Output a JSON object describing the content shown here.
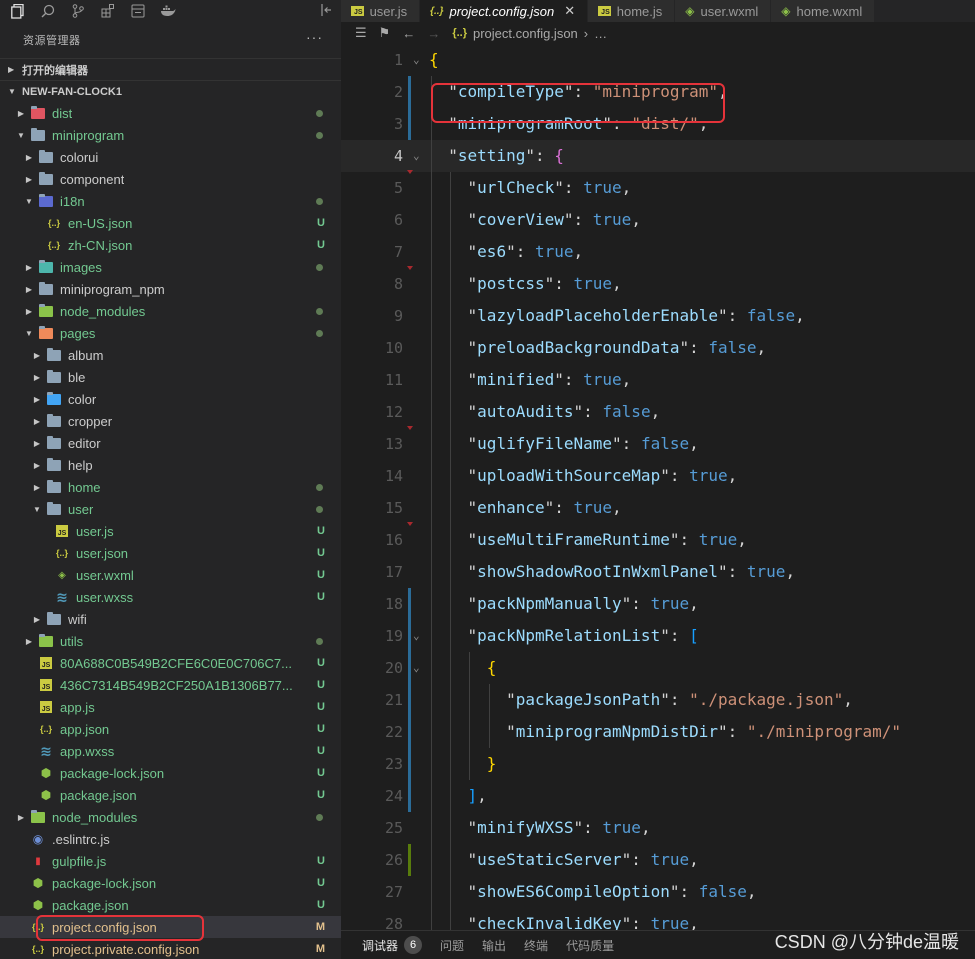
{
  "sidebar": {
    "title": "资源管理器",
    "more_label": "···",
    "open_editors_label": "打开的编辑器",
    "project_label": "NEW-FAN-CLOCK1",
    "items": [
      {
        "name": "dist",
        "depth": 1,
        "kind": "folder",
        "open": false,
        "status": "dot",
        "color": "green",
        "icon_color": "#e05561"
      },
      {
        "name": "miniprogram",
        "depth": 1,
        "kind": "folder",
        "open": true,
        "status": "dot",
        "color": "green",
        "icon_color": "#8ea3b6"
      },
      {
        "name": "colorui",
        "depth": 2,
        "kind": "folder",
        "open": false,
        "status": "",
        "color": "norm",
        "icon_color": "#8ea3b6"
      },
      {
        "name": "component",
        "depth": 2,
        "kind": "folder",
        "open": false,
        "status": "",
        "color": "norm",
        "icon_color": "#8ea3b6"
      },
      {
        "name": "i18n",
        "depth": 2,
        "kind": "folder",
        "open": true,
        "status": "dot",
        "color": "green",
        "icon_color": "#5b6ad0"
      },
      {
        "name": "en-US.json",
        "depth": 3,
        "kind": "json",
        "status": "U",
        "color": "green"
      },
      {
        "name": "zh-CN.json",
        "depth": 3,
        "kind": "json",
        "status": "U",
        "color": "green"
      },
      {
        "name": "images",
        "depth": 2,
        "kind": "folder",
        "open": false,
        "status": "dot",
        "color": "green",
        "icon_color": "#4db6ac"
      },
      {
        "name": "miniprogram_npm",
        "depth": 2,
        "kind": "folder",
        "open": false,
        "status": "",
        "color": "norm",
        "icon_color": "#8ea3b6"
      },
      {
        "name": "node_modules",
        "depth": 2,
        "kind": "folder",
        "open": false,
        "status": "dot",
        "color": "green",
        "icon_color": "#8bc34a"
      },
      {
        "name": "pages",
        "depth": 2,
        "kind": "folder",
        "open": true,
        "status": "dot",
        "color": "green",
        "icon_color": "#ef8a5a"
      },
      {
        "name": "album",
        "depth": 3,
        "kind": "folder",
        "open": false,
        "status": "",
        "color": "norm",
        "icon_color": "#8ea3b6"
      },
      {
        "name": "ble",
        "depth": 3,
        "kind": "folder",
        "open": false,
        "status": "",
        "color": "norm",
        "icon_color": "#8ea3b6"
      },
      {
        "name": "color",
        "depth": 3,
        "kind": "folder",
        "open": false,
        "status": "",
        "color": "norm",
        "icon_color": "#42a5f5"
      },
      {
        "name": "cropper",
        "depth": 3,
        "kind": "folder",
        "open": false,
        "status": "",
        "color": "norm",
        "icon_color": "#8ea3b6"
      },
      {
        "name": "editor",
        "depth": 3,
        "kind": "folder",
        "open": false,
        "status": "",
        "color": "norm",
        "icon_color": "#8ea3b6"
      },
      {
        "name": "help",
        "depth": 3,
        "kind": "folder",
        "open": false,
        "status": "",
        "color": "norm",
        "icon_color": "#8ea3b6"
      },
      {
        "name": "home",
        "depth": 3,
        "kind": "folder",
        "open": false,
        "status": "dot",
        "color": "green",
        "icon_color": "#8ea3b6"
      },
      {
        "name": "user",
        "depth": 3,
        "kind": "folder",
        "open": true,
        "status": "dot",
        "color": "green",
        "icon_color": "#8ea3b6"
      },
      {
        "name": "user.js",
        "depth": 4,
        "kind": "js",
        "status": "U",
        "color": "green"
      },
      {
        "name": "user.json",
        "depth": 4,
        "kind": "json",
        "status": "U",
        "color": "green"
      },
      {
        "name": "user.wxml",
        "depth": 4,
        "kind": "wxml",
        "status": "U",
        "color": "green"
      },
      {
        "name": "user.wxss",
        "depth": 4,
        "kind": "wxss",
        "status": "U",
        "color": "green"
      },
      {
        "name": "wifi",
        "depth": 3,
        "kind": "folder",
        "open": false,
        "status": "",
        "color": "norm",
        "icon_color": "#8ea3b6"
      },
      {
        "name": "utils",
        "depth": 2,
        "kind": "folder",
        "open": false,
        "status": "dot",
        "color": "green",
        "icon_color": "#8bc34a"
      },
      {
        "name": "80A688C0B549B2CFE6C0E0C706C7...",
        "depth": 2,
        "kind": "js",
        "status": "U",
        "color": "green"
      },
      {
        "name": "436C7314B549B2CF250A1B1306B77...",
        "depth": 2,
        "kind": "js",
        "status": "U",
        "color": "green"
      },
      {
        "name": "app.js",
        "depth": 2,
        "kind": "js",
        "status": "U",
        "color": "green"
      },
      {
        "name": "app.json",
        "depth": 2,
        "kind": "json",
        "status": "U",
        "color": "green"
      },
      {
        "name": "app.wxss",
        "depth": 2,
        "kind": "wxss",
        "status": "U",
        "color": "green"
      },
      {
        "name": "package-lock.json",
        "depth": 2,
        "kind": "npm",
        "status": "U",
        "color": "green"
      },
      {
        "name": "package.json",
        "depth": 2,
        "kind": "npm",
        "status": "U",
        "color": "green"
      },
      {
        "name": "node_modules",
        "depth": 1,
        "kind": "folder",
        "open": false,
        "status": "dot",
        "color": "green",
        "icon_color": "#8bc34a"
      },
      {
        "name": ".eslintrc.js",
        "depth": 1,
        "kind": "eslint",
        "status": "",
        "color": "norm"
      },
      {
        "name": "gulpfile.js",
        "depth": 1,
        "kind": "gulp",
        "status": "U",
        "color": "green"
      },
      {
        "name": "package-lock.json",
        "depth": 1,
        "kind": "npm",
        "status": "U",
        "color": "green"
      },
      {
        "name": "package.json",
        "depth": 1,
        "kind": "npm",
        "status": "U",
        "color": "green"
      },
      {
        "name": "project.config.json",
        "depth": 1,
        "kind": "json",
        "status": "M",
        "color": "mod",
        "selected": true,
        "boxed": true
      },
      {
        "name": "project.private.config.json",
        "depth": 1,
        "kind": "json",
        "status": "M",
        "color": "mod"
      }
    ]
  },
  "tabs": [
    {
      "label": "user.js",
      "kind": "js",
      "active": false
    },
    {
      "label": "project.config.json",
      "kind": "json",
      "active": true
    },
    {
      "label": "home.js",
      "kind": "js",
      "active": false
    },
    {
      "label": "user.wxml",
      "kind": "wxml",
      "active": false
    },
    {
      "label": "home.wxml",
      "kind": "wxml",
      "active": false
    }
  ],
  "breadcrumb": {
    "file": "project.config.json",
    "rest": "…"
  },
  "code_lines": [
    {
      "n": 1,
      "parts": [
        [
          "y",
          "{"
        ]
      ]
    },
    {
      "n": 2,
      "parts": [
        [
          "p",
          "  \""
        ],
        [
          "k",
          "compileType"
        ],
        [
          "p",
          "\": "
        ],
        [
          "s",
          "\"miniprogram\""
        ],
        [
          "p",
          ","
        ]
      ]
    },
    {
      "n": 3,
      "parts": [
        [
          "p",
          "  \""
        ],
        [
          "k",
          "miniprogramRoot"
        ],
        [
          "p",
          "\": "
        ],
        [
          "s",
          "\"dist/\""
        ],
        [
          "p",
          ","
        ]
      ]
    },
    {
      "n": 4,
      "parts": [
        [
          "p",
          "  \""
        ],
        [
          "k",
          "setting"
        ],
        [
          "p",
          "\": "
        ],
        [
          "m",
          "{"
        ]
      ]
    },
    {
      "n": 5,
      "parts": [
        [
          "p",
          "    \""
        ],
        [
          "k",
          "urlCheck"
        ],
        [
          "p",
          "\": "
        ],
        [
          "b",
          "true"
        ],
        [
          "p",
          ","
        ]
      ]
    },
    {
      "n": 6,
      "parts": [
        [
          "p",
          "    \""
        ],
        [
          "k",
          "coverView"
        ],
        [
          "p",
          "\": "
        ],
        [
          "b",
          "true"
        ],
        [
          "p",
          ","
        ]
      ]
    },
    {
      "n": 7,
      "parts": [
        [
          "p",
          "    \""
        ],
        [
          "k",
          "es6"
        ],
        [
          "p",
          "\": "
        ],
        [
          "b",
          "true"
        ],
        [
          "p",
          ","
        ]
      ]
    },
    {
      "n": 8,
      "parts": [
        [
          "p",
          "    \""
        ],
        [
          "k",
          "postcss"
        ],
        [
          "p",
          "\": "
        ],
        [
          "b",
          "true"
        ],
        [
          "p",
          ","
        ]
      ]
    },
    {
      "n": 9,
      "parts": [
        [
          "p",
          "    \""
        ],
        [
          "k",
          "lazyloadPlaceholderEnable"
        ],
        [
          "p",
          "\": "
        ],
        [
          "b",
          "false"
        ],
        [
          "p",
          ","
        ]
      ]
    },
    {
      "n": 10,
      "parts": [
        [
          "p",
          "    \""
        ],
        [
          "k",
          "preloadBackgroundData"
        ],
        [
          "p",
          "\": "
        ],
        [
          "b",
          "false"
        ],
        [
          "p",
          ","
        ]
      ]
    },
    {
      "n": 11,
      "parts": [
        [
          "p",
          "    \""
        ],
        [
          "k",
          "minified"
        ],
        [
          "p",
          "\": "
        ],
        [
          "b",
          "true"
        ],
        [
          "p",
          ","
        ]
      ]
    },
    {
      "n": 12,
      "parts": [
        [
          "p",
          "    \""
        ],
        [
          "k",
          "autoAudits"
        ],
        [
          "p",
          "\": "
        ],
        [
          "b",
          "false"
        ],
        [
          "p",
          ","
        ]
      ]
    },
    {
      "n": 13,
      "parts": [
        [
          "p",
          "    \""
        ],
        [
          "k",
          "uglifyFileName"
        ],
        [
          "p",
          "\": "
        ],
        [
          "b",
          "false"
        ],
        [
          "p",
          ","
        ]
      ]
    },
    {
      "n": 14,
      "parts": [
        [
          "p",
          "    \""
        ],
        [
          "k",
          "uploadWithSourceMap"
        ],
        [
          "p",
          "\": "
        ],
        [
          "b",
          "true"
        ],
        [
          "p",
          ","
        ]
      ]
    },
    {
      "n": 15,
      "parts": [
        [
          "p",
          "    \""
        ],
        [
          "k",
          "enhance"
        ],
        [
          "p",
          "\": "
        ],
        [
          "b",
          "true"
        ],
        [
          "p",
          ","
        ]
      ]
    },
    {
      "n": 16,
      "parts": [
        [
          "p",
          "    \""
        ],
        [
          "k",
          "useMultiFrameRuntime"
        ],
        [
          "p",
          "\": "
        ],
        [
          "b",
          "true"
        ],
        [
          "p",
          ","
        ]
      ]
    },
    {
      "n": 17,
      "parts": [
        [
          "p",
          "    \""
        ],
        [
          "k",
          "showShadowRootInWxmlPanel"
        ],
        [
          "p",
          "\": "
        ],
        [
          "b",
          "true"
        ],
        [
          "p",
          ","
        ]
      ]
    },
    {
      "n": 18,
      "parts": [
        [
          "p",
          "    \""
        ],
        [
          "k",
          "packNpmManually"
        ],
        [
          "p",
          "\": "
        ],
        [
          "b",
          "true"
        ],
        [
          "p",
          ","
        ]
      ]
    },
    {
      "n": 19,
      "parts": [
        [
          "p",
          "    \""
        ],
        [
          "k",
          "packNpmRelationList"
        ],
        [
          "p",
          "\": "
        ],
        [
          "bl",
          "["
        ]
      ]
    },
    {
      "n": 20,
      "parts": [
        [
          "p",
          "      "
        ],
        [
          "y",
          "{"
        ]
      ]
    },
    {
      "n": 21,
      "parts": [
        [
          "p",
          "        \""
        ],
        [
          "k",
          "packageJsonPath"
        ],
        [
          "p",
          "\": "
        ],
        [
          "s",
          "\"./package.json\""
        ],
        [
          "p",
          ","
        ]
      ]
    },
    {
      "n": 22,
      "parts": [
        [
          "p",
          "        \""
        ],
        [
          "k",
          "miniprogramNpmDistDir"
        ],
        [
          "p",
          "\": "
        ],
        [
          "s",
          "\"./miniprogram/\""
        ]
      ]
    },
    {
      "n": 23,
      "parts": [
        [
          "p",
          "      "
        ],
        [
          "y",
          "}"
        ]
      ]
    },
    {
      "n": 24,
      "parts": [
        [
          "p",
          "    "
        ],
        [
          "bl",
          "]"
        ],
        [
          "p",
          ","
        ]
      ]
    },
    {
      "n": 25,
      "parts": [
        [
          "p",
          "    \""
        ],
        [
          "k",
          "minifyWXSS"
        ],
        [
          "p",
          "\": "
        ],
        [
          "b",
          "true"
        ],
        [
          "p",
          ","
        ]
      ]
    },
    {
      "n": 26,
      "parts": [
        [
          "p",
          "    \""
        ],
        [
          "k",
          "useStaticServer"
        ],
        [
          "p",
          "\": "
        ],
        [
          "b",
          "true"
        ],
        [
          "p",
          ","
        ]
      ]
    },
    {
      "n": 27,
      "parts": [
        [
          "p",
          "    \""
        ],
        [
          "k",
          "showES6CompileOption"
        ],
        [
          "p",
          "\": "
        ],
        [
          "b",
          "false"
        ],
        [
          "p",
          ","
        ]
      ]
    },
    {
      "n": 28,
      "parts": [
        [
          "p",
          "    \""
        ],
        [
          "k",
          "checkInvalidKey"
        ],
        [
          "p",
          "\": "
        ],
        [
          "b",
          "true"
        ],
        [
          "p",
          ","
        ]
      ]
    }
  ],
  "panel": {
    "tabs": [
      {
        "label": "调试器",
        "badge": "6",
        "active": true
      },
      {
        "label": "问题",
        "active": false
      },
      {
        "label": "输出",
        "active": false
      },
      {
        "label": "终端",
        "active": false
      },
      {
        "label": "代码质量",
        "active": false
      }
    ]
  },
  "watermark": "CSDN @八分钟de温暖",
  "colors": {
    "highlight_box": "#e5333a",
    "git_untracked": "#73c991",
    "git_modified": "#e2c08d"
  }
}
